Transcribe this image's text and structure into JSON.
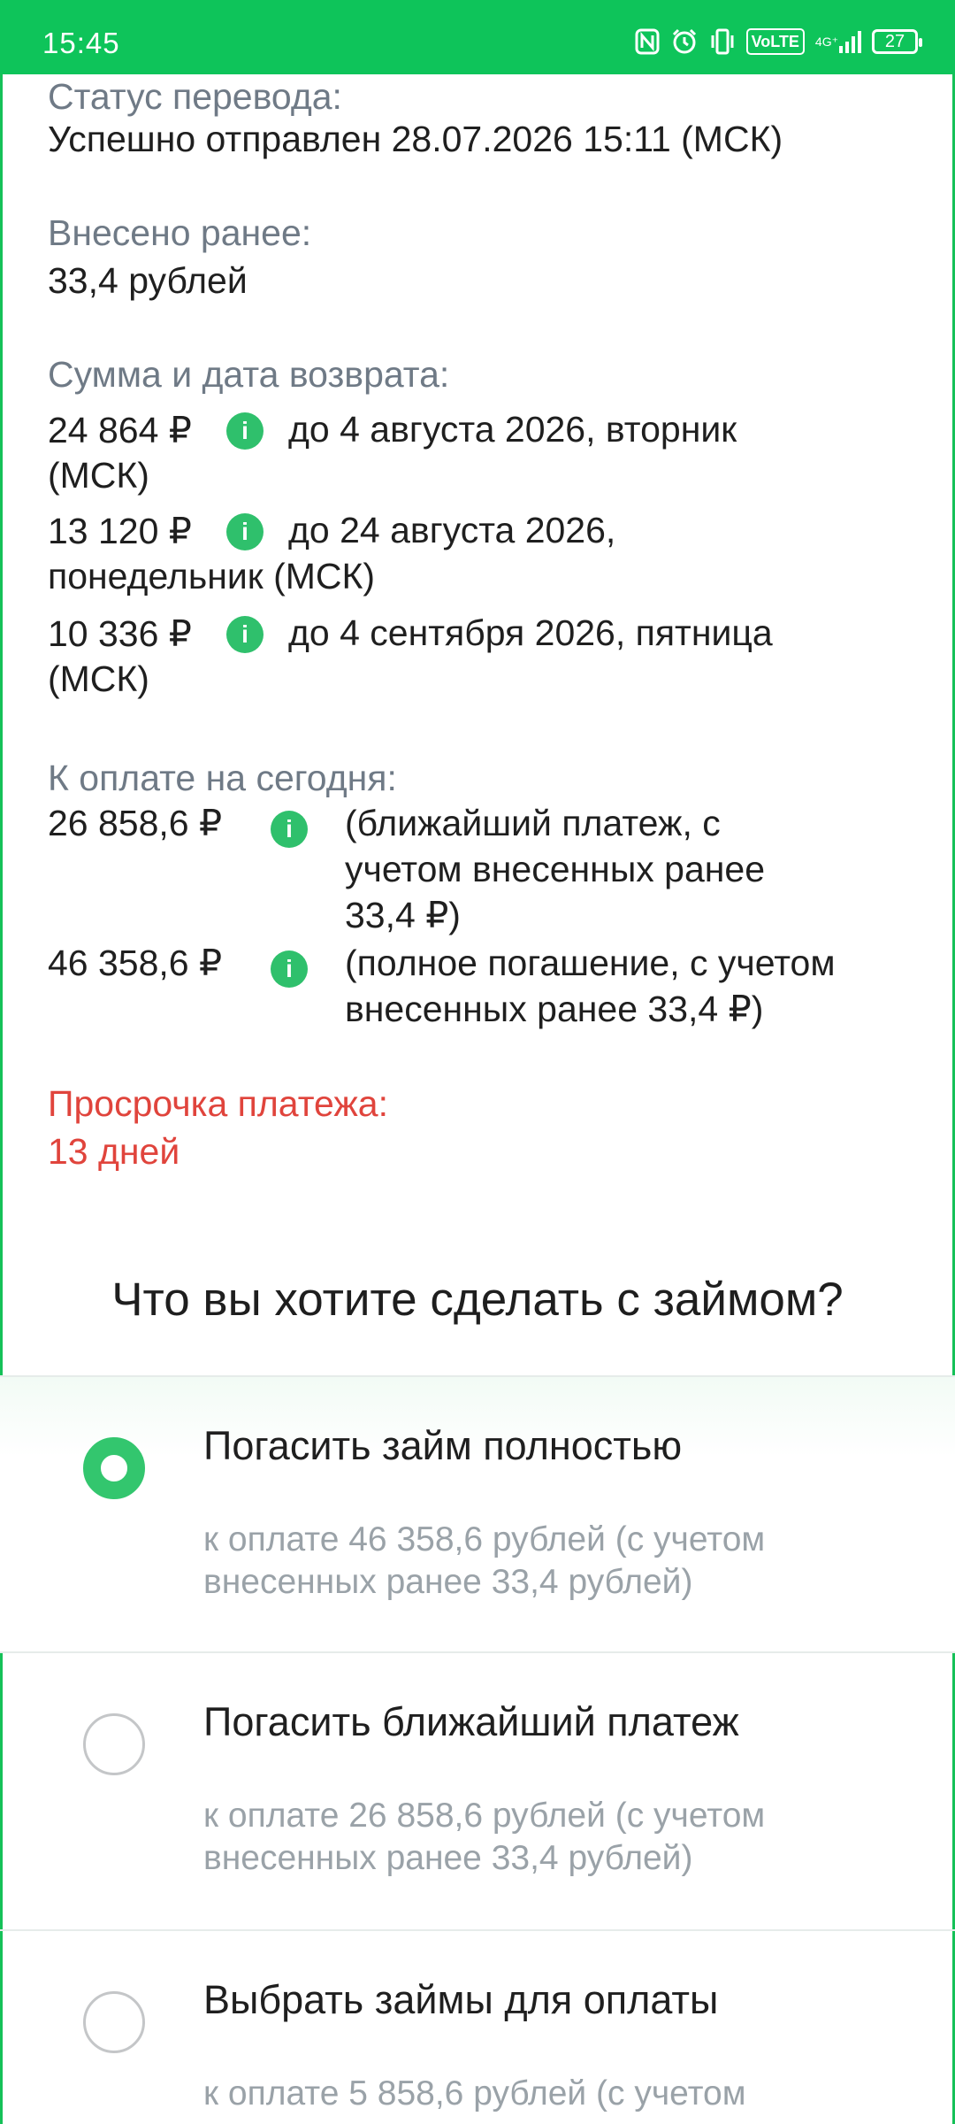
{
  "status_bar": {
    "time": "15:45",
    "icons": [
      "nfc-icon",
      "alarm-icon",
      "vibrate-icon",
      "volte-icon",
      "signal-4g-icon",
      "battery-icon"
    ],
    "volte": "VoLTE",
    "network": "4G⁺",
    "battery": "27"
  },
  "transfer": {
    "status_label": "Статус перевода:",
    "status_value": "Успешно отправлен 28.07.2026 15:11 (МСК)"
  },
  "prepaid": {
    "label": "Внесено ранее:",
    "value": "33,4 рублей"
  },
  "schedule": {
    "label": "Сумма и дата возврата:",
    "items": [
      {
        "amount": "24 864 ₽",
        "line1": "до 4 августа 2026, вторник",
        "line2": "(МСК)"
      },
      {
        "amount": "13 120 ₽",
        "line1": "до 24 августа 2026,",
        "line2": "понедельник (МСК)"
      },
      {
        "amount": "10 336 ₽",
        "line1": "до 4 сентября 2026, пятница",
        "line2": "(МСК)"
      }
    ]
  },
  "due_today": {
    "label": "К оплате на сегодня:",
    "items": [
      {
        "amount": "26 858,6 ₽",
        "l1": "(ближайший платеж, с",
        "l2": "учетом внесенных ранее",
        "l3": "33,4 ₽)"
      },
      {
        "amount": "46 358,6 ₽",
        "l1": "(полное погашение, с учетом",
        "l2": "внесенных ранее 33,4 ₽)",
        "l3": ""
      }
    ]
  },
  "overdue": {
    "label": "Просрочка платежа:",
    "value": "13 дней"
  },
  "question": "Что вы хотите сделать с займом?",
  "options": [
    {
      "title": "Погасить займ полностью",
      "sub1": "к оплате 46 358,6 рублей (с учетом",
      "sub2": "внесенных ранее 33,4 рублей)",
      "selected": true
    },
    {
      "title": "Погасить ближайший платеж",
      "sub1": "к оплате 26 858,6 рублей (с учетом",
      "sub2": "внесенных ранее 33,4 рублей)",
      "selected": false
    },
    {
      "title": "Выбрать займы для оплаты",
      "sub1": "к оплате 5 858,6 рублей (с учетом",
      "sub2": "",
      "selected": false
    }
  ],
  "colors": {
    "accent": "#0ec45a",
    "overdue": "#e0443c",
    "muted": "#6f7a86"
  }
}
